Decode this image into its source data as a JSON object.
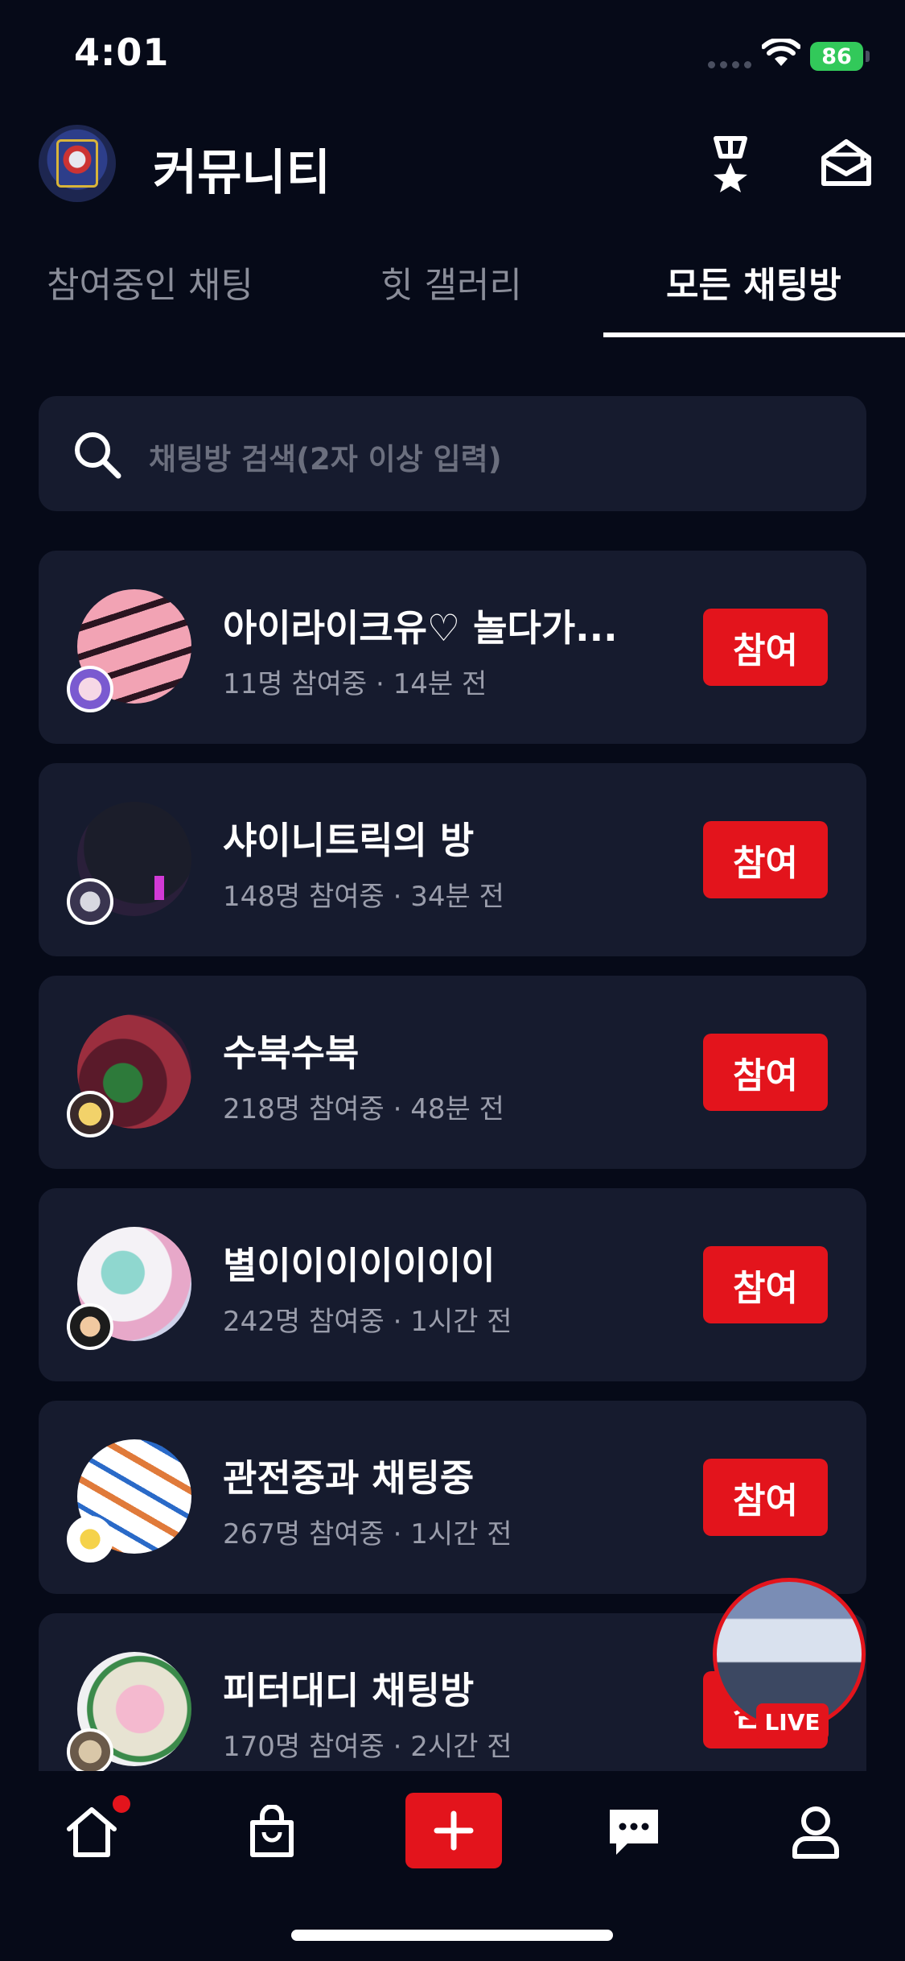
{
  "status_bar": {
    "time": "4:01",
    "battery": "86"
  },
  "header": {
    "title": "커뮤니티",
    "icons": [
      "medal-icon",
      "mailbox-icon"
    ]
  },
  "tabs": [
    {
      "label": "참여중인 채팅",
      "active": false
    },
    {
      "label": "힛 갤러리",
      "active": false
    },
    {
      "label": "모든 채팅방",
      "active": true
    }
  ],
  "search": {
    "placeholder": "채팅방 검색(2자 이상 입력)"
  },
  "rooms": [
    {
      "title": "아이라이크유♡ 놀다가...",
      "meta": "11명 참여중 · 14분 전",
      "button": "참여"
    },
    {
      "title": "샤이니트릭의 방",
      "meta": "148명 참여중 · 34분 전",
      "button": "참여"
    },
    {
      "title": "수북수북",
      "meta": "218명 참여중 · 48분 전",
      "button": "참여"
    },
    {
      "title": "별이이이이이이이",
      "meta": "242명 참여중 · 1시간 전",
      "button": "참여"
    },
    {
      "title": "관전중과 채팅중",
      "meta": "267명 참여중 · 1시간 전",
      "button": "참여"
    },
    {
      "title": "피터대디 채팅방",
      "meta": "170명 참여중 · 2시간 전",
      "button": "참여"
    }
  ],
  "live": {
    "label": "LIVE"
  },
  "bottom_nav": {
    "items": [
      "home-icon",
      "shopping-bag-icon",
      "plus-icon",
      "chat-bubble-icon",
      "profile-icon"
    ],
    "home_has_notification": true
  },
  "colors": {
    "background": "#060a18",
    "card": "#161b2e",
    "accent": "#e3141c"
  }
}
